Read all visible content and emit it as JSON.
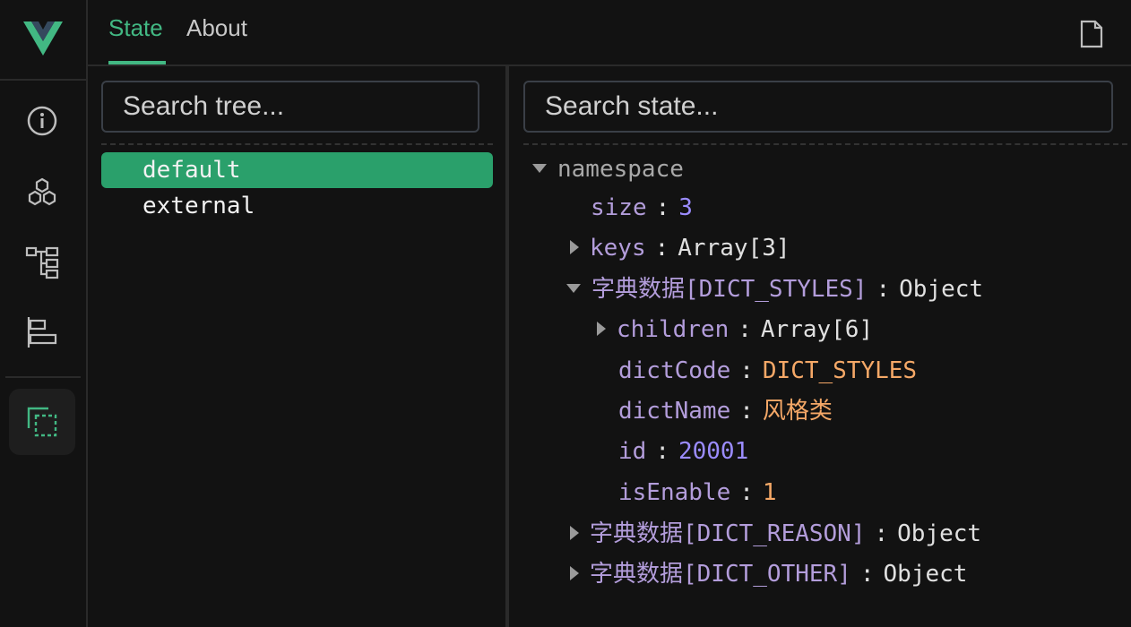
{
  "tabs": [
    {
      "label": "State",
      "active": true
    },
    {
      "label": "About",
      "active": false
    }
  ],
  "sidebar": {
    "icons": [
      "vue-logo-icon",
      "info-icon",
      "components-icon",
      "tree-icon",
      "timeline-icon",
      "pinia-icon"
    ],
    "active": "pinia-icon"
  },
  "tree_search": {
    "placeholder": "Search tree..."
  },
  "state_search": {
    "placeholder": "Search state..."
  },
  "tree_items": [
    {
      "label": "default",
      "selected": true
    },
    {
      "label": "external",
      "selected": false
    }
  ],
  "state": {
    "namespace": "namespace",
    "size_key": "size",
    "size_val": "3",
    "keys_key": "keys",
    "keys_val": "Array[3]",
    "styles_key": "字典数据[DICT_STYLES]",
    "styles_val": "Object",
    "children_key": "children",
    "children_val": "Array[6]",
    "dictCode_key": "dictCode",
    "dictCode_val": "DICT_STYLES",
    "dictName_key": "dictName",
    "dictName_val": "风格类",
    "id_key": "id",
    "id_val": "20001",
    "isEnable_key": "isEnable",
    "isEnable_val": "1",
    "reason_key": "字典数据[DICT_REASON]",
    "reason_val": "Object",
    "other_key": "字典数据[DICT_OTHER]",
    "other_val": "Object"
  },
  "colors": {
    "accent": "#42b883",
    "selected_bg": "#2aa06b",
    "number": "#9b8cff",
    "string": "#f5a867",
    "key": "#b39ddb"
  }
}
